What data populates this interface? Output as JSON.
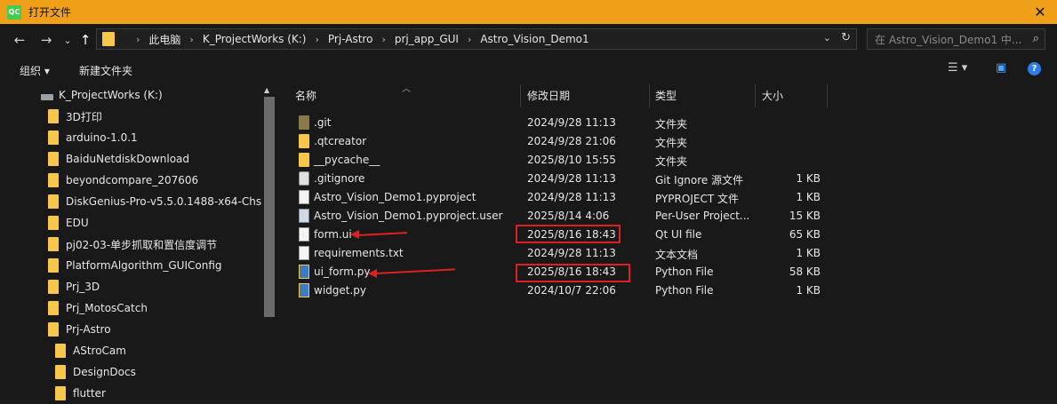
{
  "window": {
    "icon_text": "QC",
    "title": "打开文件",
    "close_glyph": "✕"
  },
  "nav": {
    "back_glyph": "←",
    "forward_glyph": "→",
    "chevron_glyph": "⌄",
    "up_glyph": "↑"
  },
  "address": {
    "crumbs": [
      "此电脑",
      "K_ProjectWorks (K:)",
      "Prj-Astro",
      "prj_app_GUI",
      "Astro_Vision_Demo1"
    ],
    "separator": "›",
    "dropdown_glyph": "⌄",
    "refresh_glyph": "↻"
  },
  "search": {
    "placeholder": "在 Astro_Vision_Demo1 中...",
    "icon_glyph": "⌕"
  },
  "toolbar": {
    "organize": "组织 ▾",
    "new_folder": "新建文件夹",
    "view_glyph": "☰ ▾",
    "pane_glyph": "▣",
    "help_glyph": "?"
  },
  "sidebar": {
    "drive": "K_ProjectWorks (K:)",
    "items": [
      {
        "label": "3D打印",
        "level": 1
      },
      {
        "label": "arduino-1.0.1",
        "level": 1
      },
      {
        "label": "BaiduNetdiskDownload",
        "level": 1
      },
      {
        "label": "beyondcompare_207606",
        "level": 1
      },
      {
        "label": "DiskGenius-Pro-v5.5.0.1488-x64-Chs",
        "level": 1
      },
      {
        "label": "EDU",
        "level": 1
      },
      {
        "label": "pj02-03-单步抓取和置信度调节",
        "level": 1
      },
      {
        "label": "PlatformAlgorithm_GUIConfig",
        "level": 1
      },
      {
        "label": "Prj_3D",
        "level": 1
      },
      {
        "label": "Prj_MotosCatch",
        "level": 1
      },
      {
        "label": "Prj-Astro",
        "level": 1
      },
      {
        "label": "AStroCam",
        "level": 2
      },
      {
        "label": "DesignDocs",
        "level": 2
      },
      {
        "label": "flutter",
        "level": 2
      }
    ],
    "scroll_up_glyph": "▲"
  },
  "columns": {
    "name": "名称",
    "date": "修改日期",
    "type": "类型",
    "size": "大小",
    "sort_glyph": "︿"
  },
  "files": [
    {
      "name": ".git",
      "date": "2024/9/28 11:13",
      "type": "文件夹",
      "size": "",
      "icon": "folder-dark"
    },
    {
      "name": ".qtcreator",
      "date": "2024/9/28 21:06",
      "type": "文件夹",
      "size": "",
      "icon": "folder"
    },
    {
      "name": "__pycache__",
      "date": "2025/8/10 15:55",
      "type": "文件夹",
      "size": "",
      "icon": "folder"
    },
    {
      "name": ".gitignore",
      "date": "2024/9/28 11:13",
      "type": "Git Ignore 源文件",
      "size": "1 KB",
      "icon": "gear"
    },
    {
      "name": "Astro_Vision_Demo1.pyproject",
      "date": "2024/9/28 11:13",
      "type": "PYPROJECT 文件",
      "size": "1 KB",
      "icon": "doc"
    },
    {
      "name": "Astro_Vision_Demo1.pyproject.user",
      "date": "2025/8/14 4:06",
      "type": "Per-User Project...",
      "size": "15 KB",
      "icon": "pyproj"
    },
    {
      "name": "form.ui",
      "date": "2025/8/16 18:43",
      "type": "Qt UI file",
      "size": "65 KB",
      "icon": "ui"
    },
    {
      "name": "requirements.txt",
      "date": "2024/9/28 11:13",
      "type": "文本文档",
      "size": "1 KB",
      "icon": "doc"
    },
    {
      "name": "ui_form.py",
      "date": "2025/8/16 18:43",
      "type": "Python File",
      "size": "58 KB",
      "icon": "py"
    },
    {
      "name": "widget.py",
      "date": "2024/10/7 22:06",
      "type": "Python File",
      "size": "1 KB",
      "icon": "py"
    }
  ],
  "colors": {
    "titlebar": "#f0a018",
    "annotation": "#e02020"
  }
}
